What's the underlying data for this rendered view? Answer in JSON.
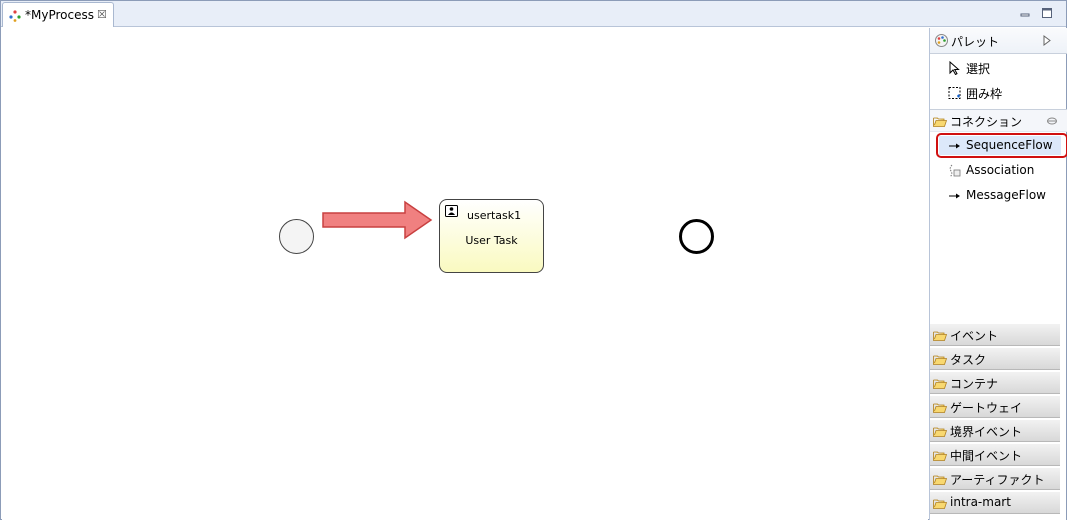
{
  "editor": {
    "tab_title": "*MyProcess",
    "icons": {
      "tab": "process-icon",
      "close": "close-icon",
      "minimize": "minimize-icon",
      "maximize": "maximize-icon"
    }
  },
  "canvas": {
    "user_task": {
      "name": "usertask1",
      "type_label": "User Task",
      "icon": "user-icon"
    },
    "annotation_color": "#f08080"
  },
  "palette": {
    "title": "パレット",
    "tools": [
      {
        "label": "選択",
        "icon": "pointer-icon"
      },
      {
        "label": "囲み枠",
        "icon": "marquee-icon"
      }
    ],
    "connections": {
      "label": "コネクション",
      "items": [
        {
          "label": "SequenceFlow",
          "icon": "arrow-right-icon",
          "selected": true
        },
        {
          "label": "Association",
          "icon": "association-icon"
        },
        {
          "label": "MessageFlow",
          "icon": "arrow-right-icon"
        }
      ]
    },
    "drawers": [
      {
        "label": "イベント"
      },
      {
        "label": "タスク"
      },
      {
        "label": "コンテナ"
      },
      {
        "label": "ゲートウェイ"
      },
      {
        "label": "境界イベント"
      },
      {
        "label": "中間イベント"
      },
      {
        "label": "アーティファクト"
      },
      {
        "label": "intra-mart"
      }
    ],
    "highlight_color": "#d01010"
  }
}
